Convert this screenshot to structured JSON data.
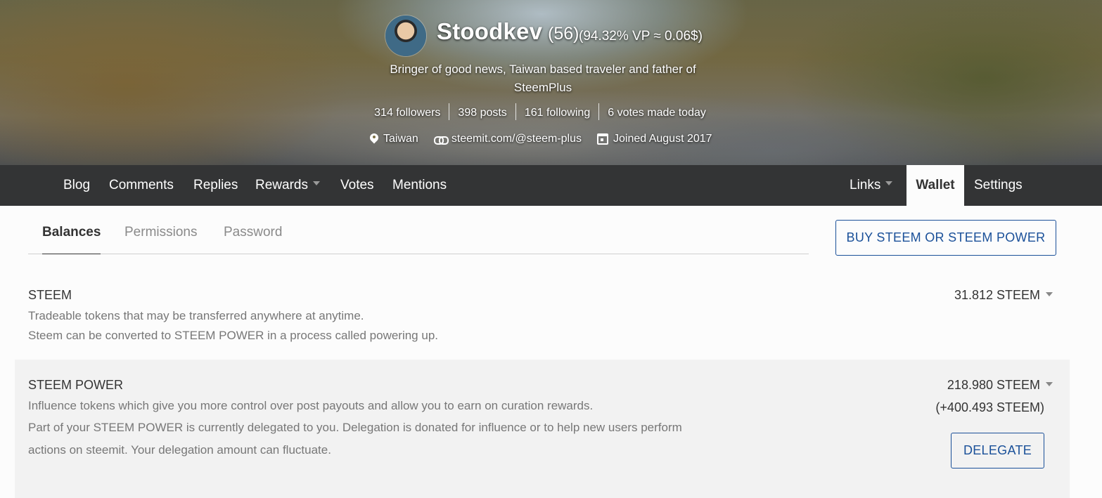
{
  "profile": {
    "name": "Stoodkev",
    "reputation": "(56)",
    "voting_power": "(94.32% VP ≈ 0.06$)",
    "about_line1": "Bringer of good news, Taiwan based traveler and father of",
    "about_line2": "SteemPlus",
    "stats": {
      "followers": "314 followers",
      "posts": "398 posts",
      "following": "161 following",
      "votes": "6 votes made today"
    },
    "location": "Taiwan",
    "website": "steemit.com/@steem-plus",
    "joined": "Joined August 2017"
  },
  "nav": {
    "left": [
      "Blog",
      "Comments",
      "Replies",
      "Rewards",
      "Votes",
      "Mentions"
    ],
    "right": [
      "Links",
      "Wallet",
      "Settings"
    ],
    "active": "Wallet"
  },
  "wallet_tabs": {
    "items": [
      "Balances",
      "Permissions",
      "Password"
    ],
    "active": "Balances"
  },
  "buy_button": "BUY STEEM OR STEEM POWER",
  "balances": {
    "steem": {
      "title": "STEEM",
      "desc1": "Tradeable tokens that may be transferred anywhere at anytime.",
      "desc2": "Steem can be converted to STEEM POWER in a process called powering up.",
      "amount": "31.812 STEEM"
    },
    "steem_power": {
      "title": "STEEM POWER",
      "desc1": "Influence tokens which give you more control over post payouts and allow you to earn on curation rewards.",
      "desc2": "Part of your STEEM POWER is currently delegated to you. Delegation is donated for influence or to help new users perform",
      "desc3": "actions on steemit. Your delegation amount can fluctuate.",
      "amount": "218.980 STEEM",
      "delegated": "(+400.493 STEEM)",
      "delegate_button": "DELEGATE"
    }
  },
  "colors": {
    "nav_bg": "#333435",
    "accent_blue": "#1a5099",
    "page_bg": "#fcfcfc",
    "row_alt_bg": "#f2f2f2"
  }
}
